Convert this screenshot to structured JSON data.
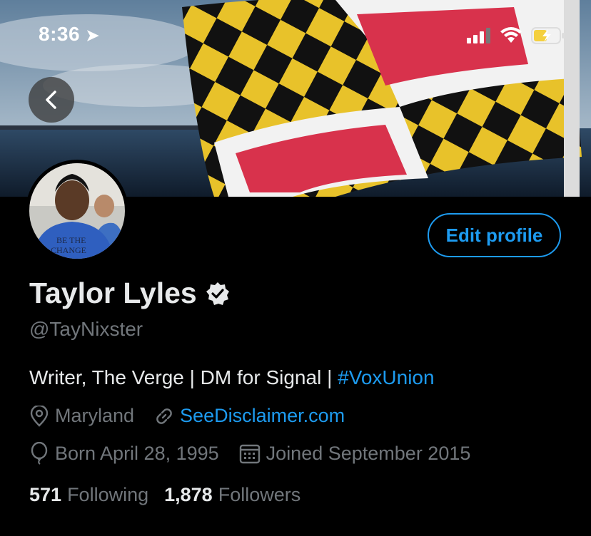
{
  "status_bar": {
    "time": "8:36"
  },
  "header": {
    "back_icon": "chevron-left-icon"
  },
  "profile": {
    "name": "Taylor Lyles",
    "verified_icon": "verified-badge-icon",
    "handle": "@TayNixster",
    "edit_button_label": "Edit profile",
    "bio_text": "Writer, The Verge | DM for Signal | ",
    "bio_hashtag": "#VoxUnion",
    "location": "Maryland",
    "website": "SeeDisclaimer.com",
    "birthday": "Born April 28, 1995",
    "joined": "Joined September 2015",
    "following_count": "571",
    "following_label": "Following",
    "followers_count": "1,878",
    "followers_label": "Followers"
  },
  "colors": {
    "accent": "#1d9bf0",
    "muted": "#71767b",
    "text": "#e7e9ea",
    "background": "#000000"
  }
}
